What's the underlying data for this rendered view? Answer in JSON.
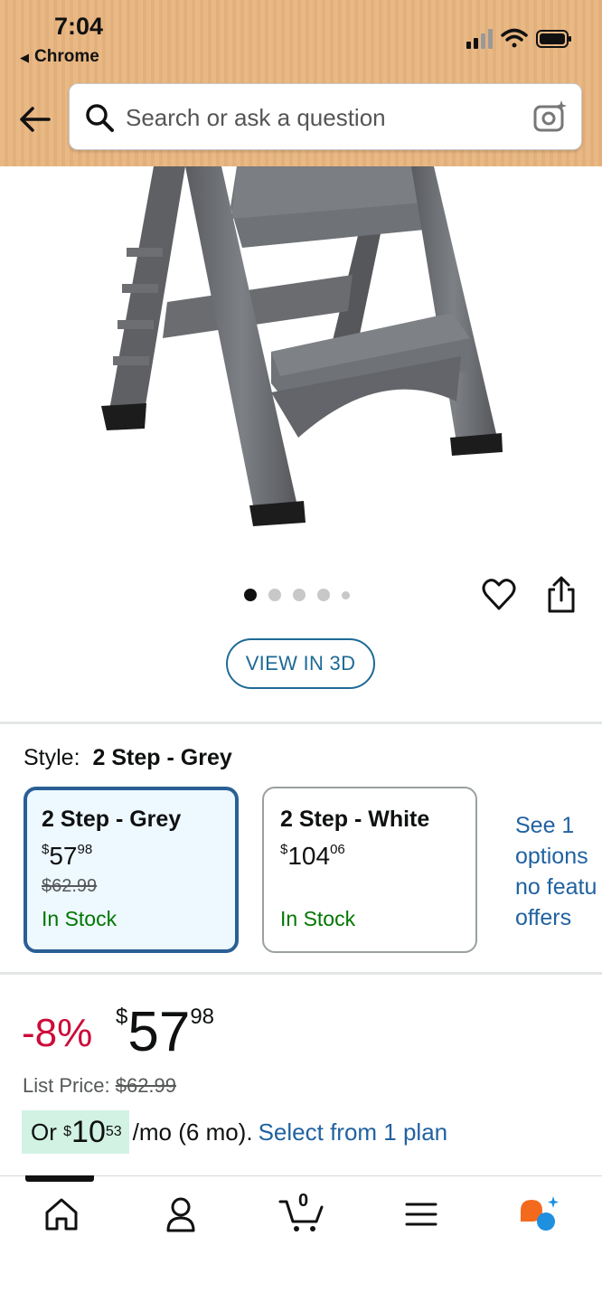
{
  "status_bar": {
    "time": "7:04",
    "back_app": "Chrome"
  },
  "search": {
    "placeholder": "Search or ask a question"
  },
  "icons": {
    "back": "left-arrow-icon",
    "search": "search-icon",
    "camera": "camera-sparkle-icon",
    "wishlist": "heart-icon",
    "share": "share-icon",
    "nav": [
      "home-icon",
      "account-icon",
      "cart-icon",
      "menu-icon",
      "rufus-assistant-icon"
    ]
  },
  "gallery": {
    "image_count": 5,
    "active_index": 0,
    "view_3d_label": "VIEW IN 3D"
  },
  "style": {
    "label": "Style:",
    "selected": "2 Step - Grey",
    "options": [
      {
        "name": "2 Step - Grey",
        "price_symbol": "$",
        "price_whole": "57",
        "price_fraction": "98",
        "list_price": "$62.99",
        "stock": "In Stock",
        "selected": true
      },
      {
        "name": "2 Step - White",
        "price_symbol": "$",
        "price_whole": "104",
        "price_fraction": "06",
        "list_price": "",
        "stock": "In Stock",
        "selected": false
      }
    ],
    "see_more": [
      "See 1",
      "options",
      "no featu",
      "offers"
    ]
  },
  "price": {
    "discount": "-8%",
    "symbol": "$",
    "whole": "57",
    "fraction": "98",
    "list_label": "List Price:",
    "list_value": "$62.99"
  },
  "monthly": {
    "prefix": "Or",
    "symbol": "$",
    "whole": "10",
    "fraction": "53",
    "suffix": "/mo (6 mo).",
    "link": "Select from 1 plan"
  },
  "cart": {
    "count": "0"
  },
  "colors": {
    "header": "#e9b985",
    "link": "#2162a1",
    "discount": "#cc0c39",
    "in_stock": "#007600",
    "selected_border": "#2a5f95"
  }
}
